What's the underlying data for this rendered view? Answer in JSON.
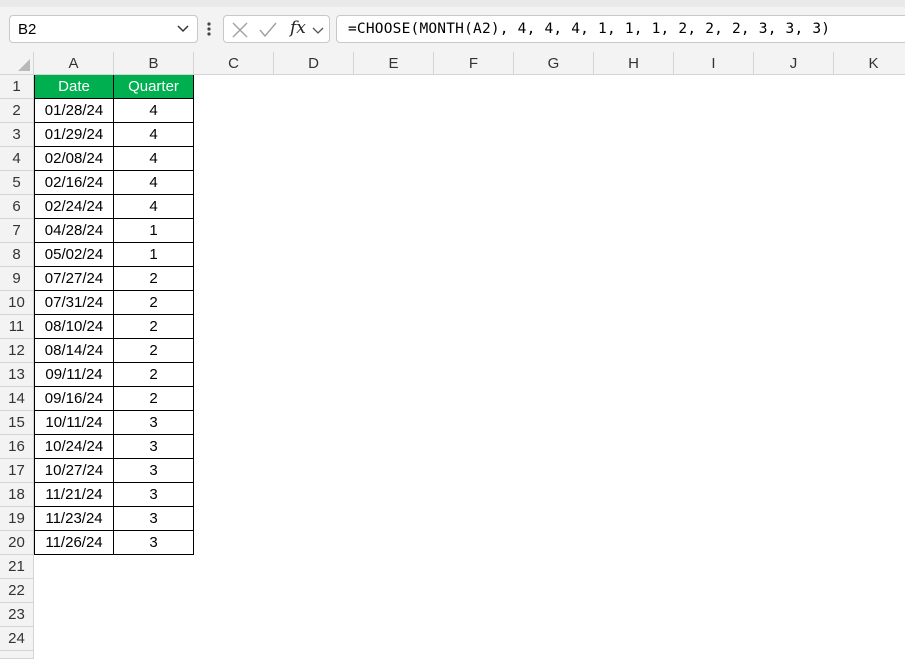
{
  "formula_bar": {
    "name_box": "B2",
    "fx_label": "fx",
    "formula": "=CHOOSE(MONTH(A2), 4, 4, 4, 1, 1, 1, 2, 2, 2, 3, 3, 3)"
  },
  "columns": [
    "A",
    "B",
    "C",
    "D",
    "E",
    "F",
    "G",
    "H",
    "I",
    "J",
    "K"
  ],
  "rows": [
    "1",
    "2",
    "3",
    "4",
    "5",
    "6",
    "7",
    "8",
    "9",
    "10",
    "11",
    "12",
    "13",
    "14",
    "15",
    "16",
    "17",
    "18",
    "19",
    "20",
    "21",
    "22",
    "23",
    "24"
  ],
  "table": {
    "headers": {
      "date": "Date",
      "quarter": "Quarter"
    },
    "data": [
      {
        "date": "01/28/24",
        "quarter": "4"
      },
      {
        "date": "01/29/24",
        "quarter": "4"
      },
      {
        "date": "02/08/24",
        "quarter": "4"
      },
      {
        "date": "02/16/24",
        "quarter": "4"
      },
      {
        "date": "02/24/24",
        "quarter": "4"
      },
      {
        "date": "04/28/24",
        "quarter": "1"
      },
      {
        "date": "05/02/24",
        "quarter": "1"
      },
      {
        "date": "07/27/24",
        "quarter": "2"
      },
      {
        "date": "07/31/24",
        "quarter": "2"
      },
      {
        "date": "08/10/24",
        "quarter": "2"
      },
      {
        "date": "08/14/24",
        "quarter": "2"
      },
      {
        "date": "09/11/24",
        "quarter": "2"
      },
      {
        "date": "09/16/24",
        "quarter": "2"
      },
      {
        "date": "10/11/24",
        "quarter": "3"
      },
      {
        "date": "10/24/24",
        "quarter": "3"
      },
      {
        "date": "10/27/24",
        "quarter": "3"
      },
      {
        "date": "11/21/24",
        "quarter": "3"
      },
      {
        "date": "11/23/24",
        "quarter": "3"
      },
      {
        "date": "11/26/24",
        "quarter": "3"
      }
    ]
  },
  "colors": {
    "header_fill": "#00b050",
    "header_text": "#ffffff"
  }
}
